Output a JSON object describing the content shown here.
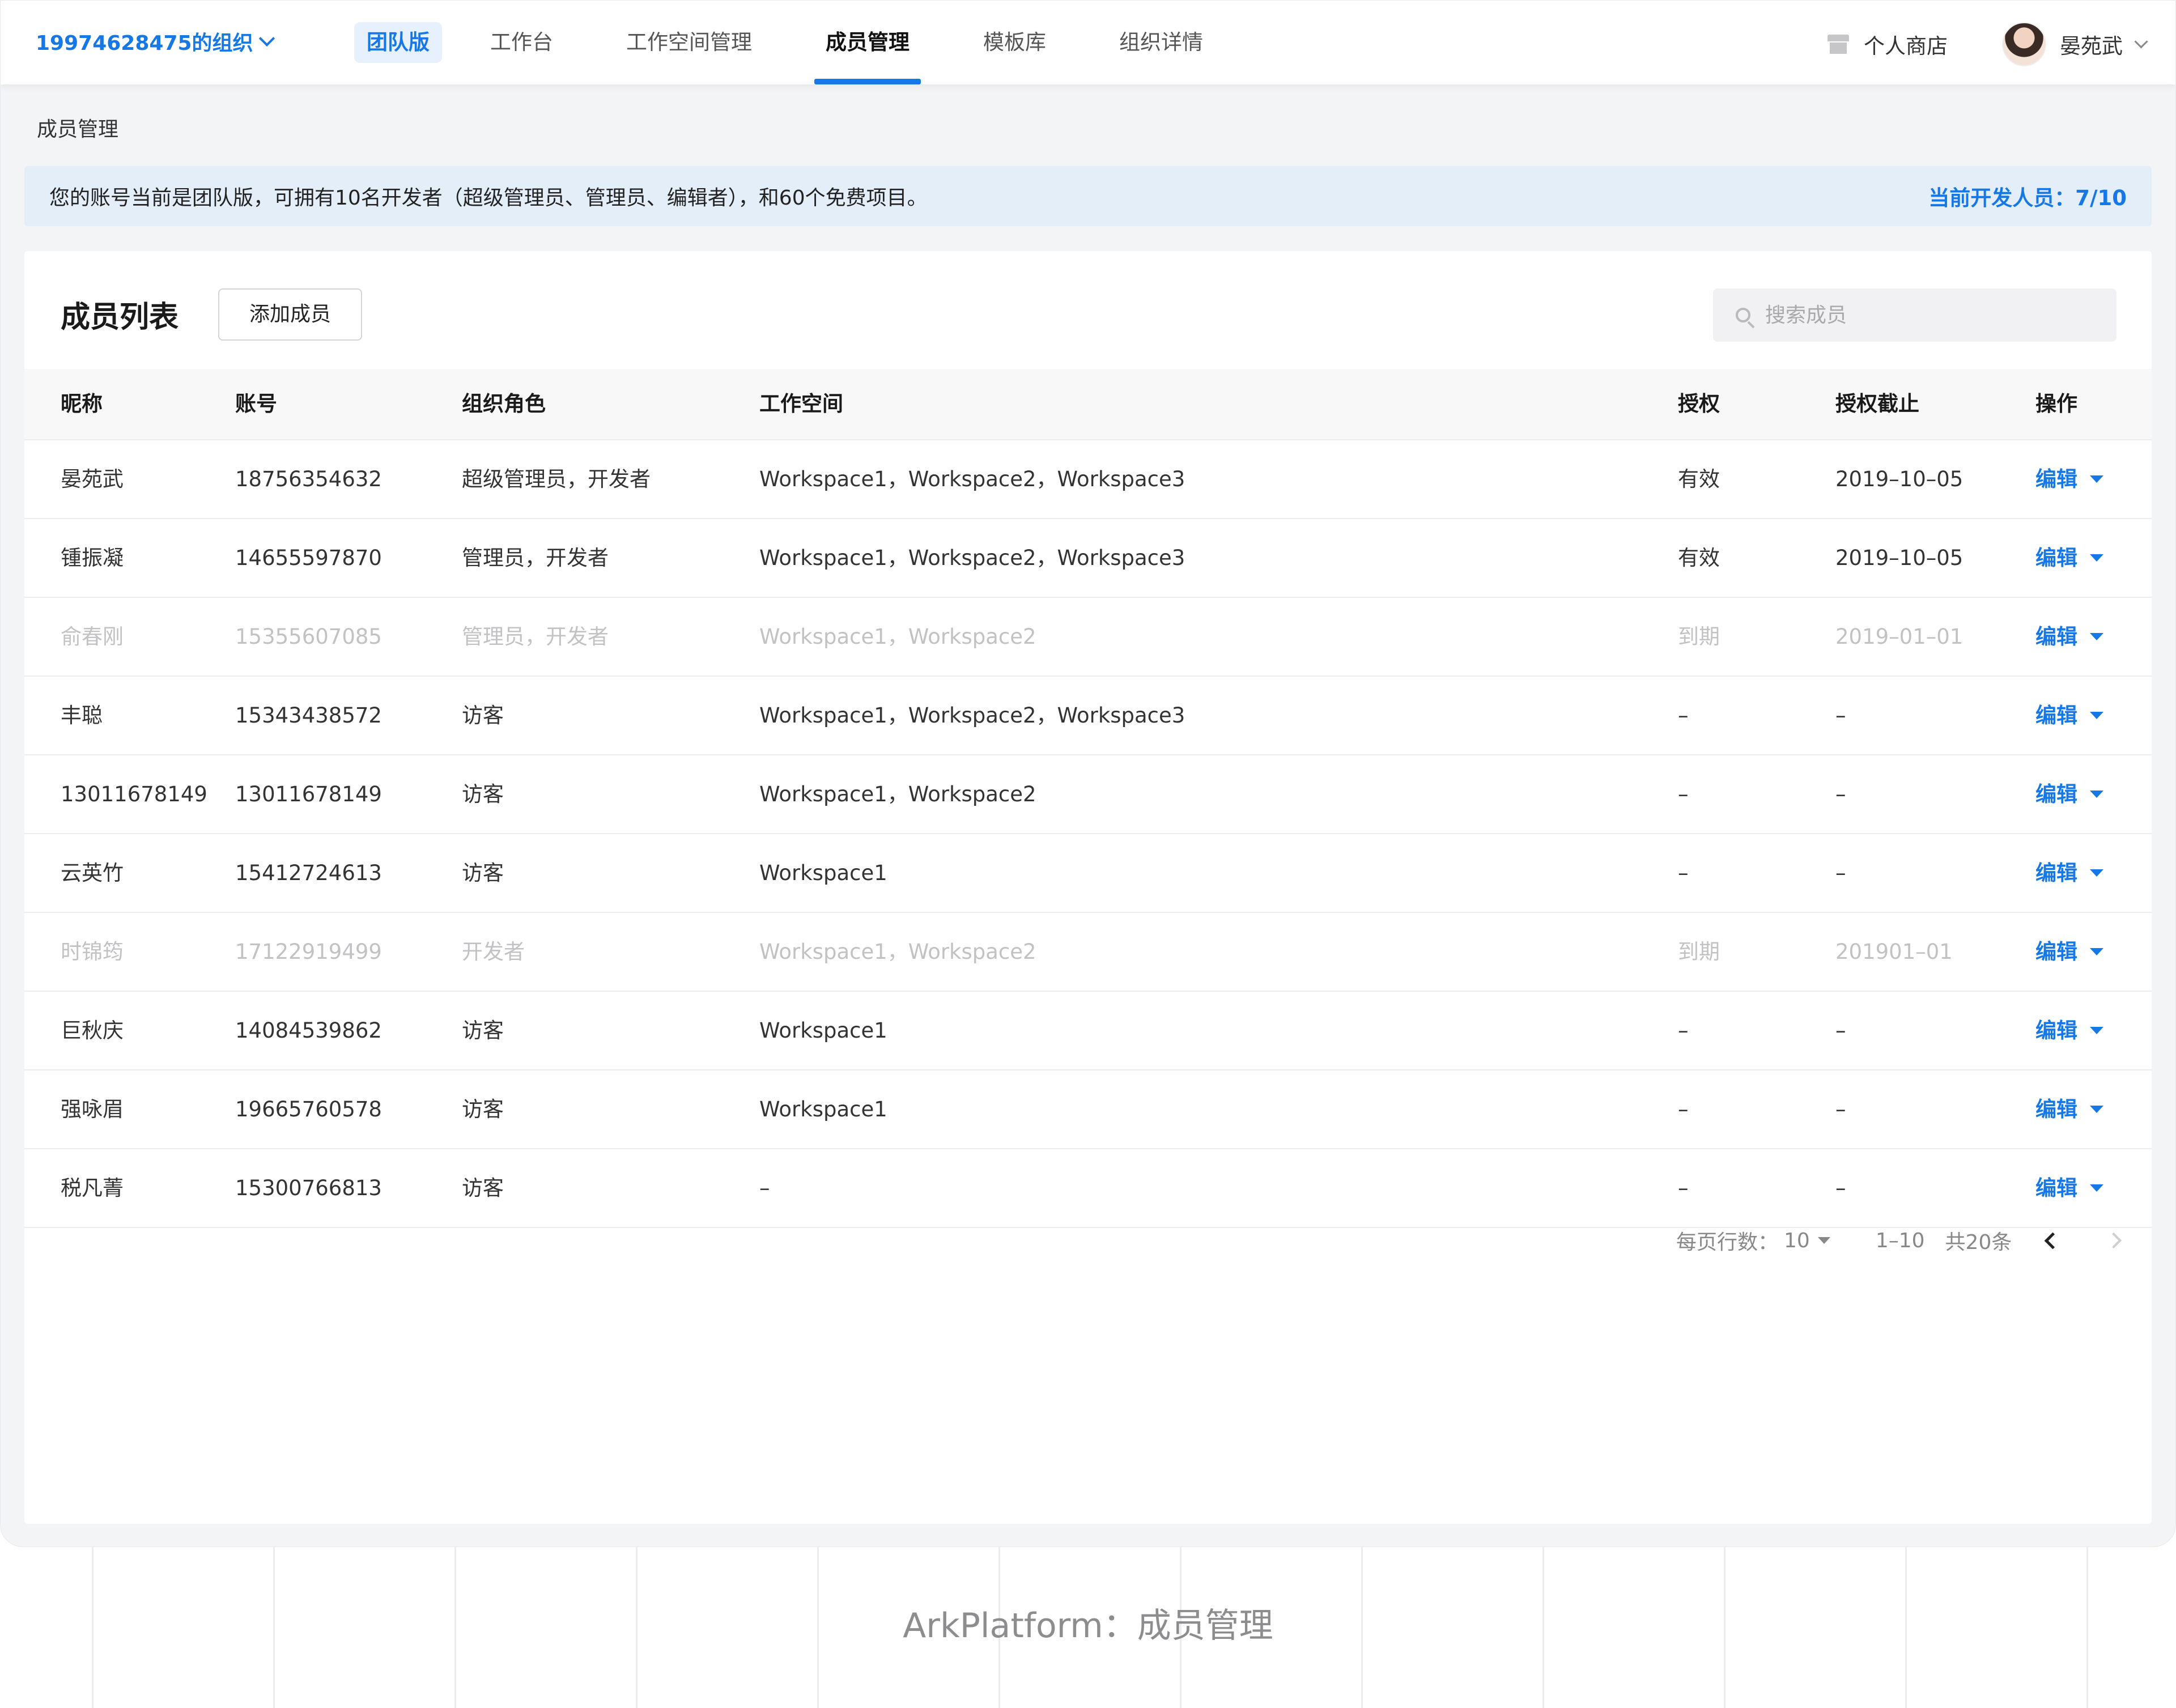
{
  "header": {
    "org_name": "19974628475的组织",
    "plan_badge": "团队版",
    "nav": [
      {
        "label": "工作台"
      },
      {
        "label": "工作空间管理"
      },
      {
        "label": "成员管理"
      },
      {
        "label": "模板库"
      },
      {
        "label": "组织详情"
      }
    ],
    "active_nav": "成员管理",
    "store_label": "个人商店",
    "user_name": "晏苑武"
  },
  "breadcrumb": "成员管理",
  "notice": {
    "message": "您的账号当前是团队版，可拥有10名开发者（超级管理员、管理员、编辑者），和60个免费项目。",
    "developer_count": "当前开发人员：7/10"
  },
  "member_list": {
    "title": "成员列表",
    "add_button": "添加成员",
    "search_placeholder": "搜索成员",
    "columns": [
      "昵称",
      "账号",
      "组织角色",
      "工作空间",
      "授权",
      "授权截止",
      "操作"
    ],
    "rows": [
      {
        "nickname": "晏苑武",
        "account": "18756354632",
        "role": "超级管理员，开发者",
        "workspace": "Workspace1，Workspace2，Workspace3",
        "auth": "有效",
        "deadline": "2019–10–05",
        "action": "编辑",
        "expired": false
      },
      {
        "nickname": "锺振凝",
        "account": "14655597870",
        "role": "管理员，开发者",
        "workspace": "Workspace1，Workspace2，Workspace3",
        "auth": "有效",
        "deadline": "2019–10–05",
        "action": "编辑",
        "expired": false
      },
      {
        "nickname": "俞春刚",
        "account": "15355607085",
        "role": "管理员，开发者",
        "workspace": "Workspace1，Workspace2",
        "auth": "到期",
        "deadline": "2019–01–01",
        "action": "编辑",
        "expired": true
      },
      {
        "nickname": "丰聪",
        "account": "15343438572",
        "role": "访客",
        "workspace": "Workspace1，Workspace2，Workspace3",
        "auth": "–",
        "deadline": "–",
        "action": "编辑",
        "expired": false
      },
      {
        "nickname": "13011678149",
        "account": "13011678149",
        "role": "访客",
        "workspace": "Workspace1，Workspace2",
        "auth": "–",
        "deadline": "–",
        "action": "编辑",
        "expired": false
      },
      {
        "nickname": "云英竹",
        "account": "15412724613",
        "role": "访客",
        "workspace": "Workspace1",
        "auth": "–",
        "deadline": "–",
        "action": "编辑",
        "expired": false
      },
      {
        "nickname": "时锦筠",
        "account": "17122919499",
        "role": "开发者",
        "workspace": "Workspace1，Workspace2",
        "auth": "到期",
        "deadline": "201901–01",
        "action": "编辑",
        "expired": true
      },
      {
        "nickname": "巨秋庆",
        "account": "14084539862",
        "role": "访客",
        "workspace": "Workspace1",
        "auth": "–",
        "deadline": "–",
        "action": "编辑",
        "expired": false
      },
      {
        "nickname": "强咏眉",
        "account": "19665760578",
        "role": "访客",
        "workspace": "Workspace1",
        "auth": "–",
        "deadline": "–",
        "action": "编辑",
        "expired": false
      },
      {
        "nickname": "税凡菁",
        "account": "15300766813",
        "role": "访客",
        "workspace": "–",
        "auth": "–",
        "deadline": "–",
        "action": "编辑",
        "expired": false
      }
    ]
  },
  "pagination": {
    "rows_per_page_label": "每页行数：",
    "rows_per_page": "10",
    "range": "1–10",
    "total": "共20条"
  },
  "caption": "ArkPlatform：成员管理",
  "colors": {
    "accent": "#1677e6",
    "notice_bg": "#e3eef9",
    "expired_text": "#c2c2c4"
  }
}
